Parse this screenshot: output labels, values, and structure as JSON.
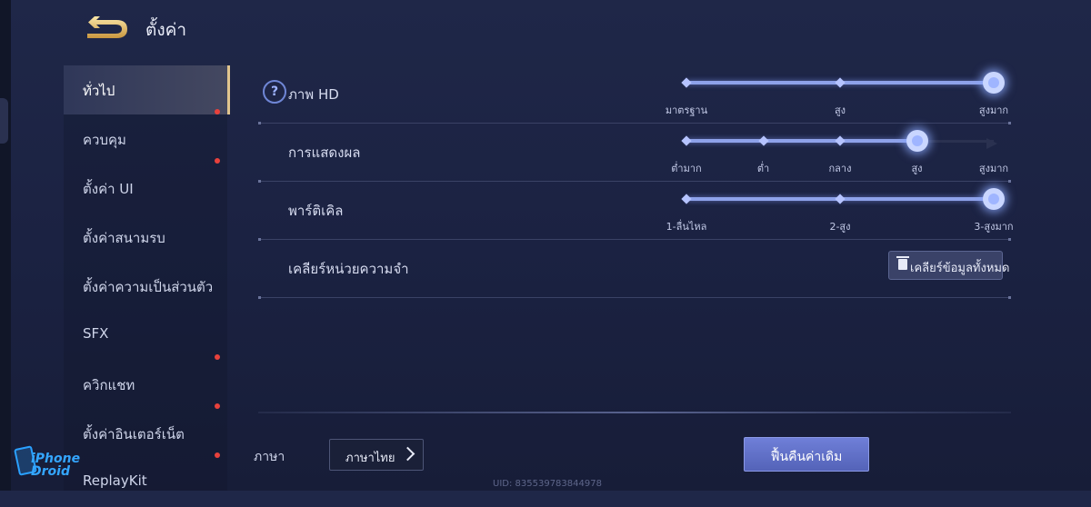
{
  "header": {
    "title": "ตั้งค่า"
  },
  "sidebar": {
    "items": [
      {
        "label": "ทั่วไป",
        "active": true,
        "dot": false
      },
      {
        "label": "ควบคุม",
        "active": false,
        "dot": true
      },
      {
        "label": "ตั้งค่า UI",
        "active": false,
        "dot": true
      },
      {
        "label": "ตั้งค่าสนามรบ",
        "active": false,
        "dot": false
      },
      {
        "label": "ตั้งค่าความเป็นส่วนตัว",
        "active": false,
        "dot": false
      },
      {
        "label": "SFX",
        "active": false,
        "dot": false
      },
      {
        "label": "ควิกแชท",
        "active": false,
        "dot": true
      },
      {
        "label": "ตั้งค่าอินเตอร์เน็ต",
        "active": false,
        "dot": true
      },
      {
        "label": "ReplayKit",
        "active": false,
        "dot": true
      }
    ]
  },
  "settings": {
    "hd": {
      "label": "ภาพ HD",
      "help": "?",
      "options": [
        "มาตรฐาน",
        "สูง",
        "สูงมาก"
      ],
      "selected_index": 2
    },
    "display": {
      "label": "การแสดงผล",
      "options": [
        "ต่ำมาก",
        "ต่ำ",
        "กลาง",
        "สูง",
        "สูงมาก"
      ],
      "selected_index": 3
    },
    "particle": {
      "label": "พาร์ติเคิล",
      "options": [
        "1-ลื่นไหล",
        "2-สูง",
        "3-สูงมาก"
      ],
      "selected_index": 2
    },
    "memory": {
      "label": "เคลียร์หน่วยความจำ",
      "button": "เคลียร์ข้อมูลทั้งหมด"
    }
  },
  "footer": {
    "language_label": "ภาษา",
    "language_value": "ภาษาไทย",
    "restore_label": "ฟื้นคืนค่าเดิม",
    "uid": "UID: 835539783844978"
  },
  "watermark": {
    "line1": "iPhone",
    "line2": "Droid"
  },
  "colors": {
    "accent": "#8ea2ea",
    "active_border": "#e1c58e",
    "dot": "#e8413c",
    "restore": "#5f6fc8"
  }
}
